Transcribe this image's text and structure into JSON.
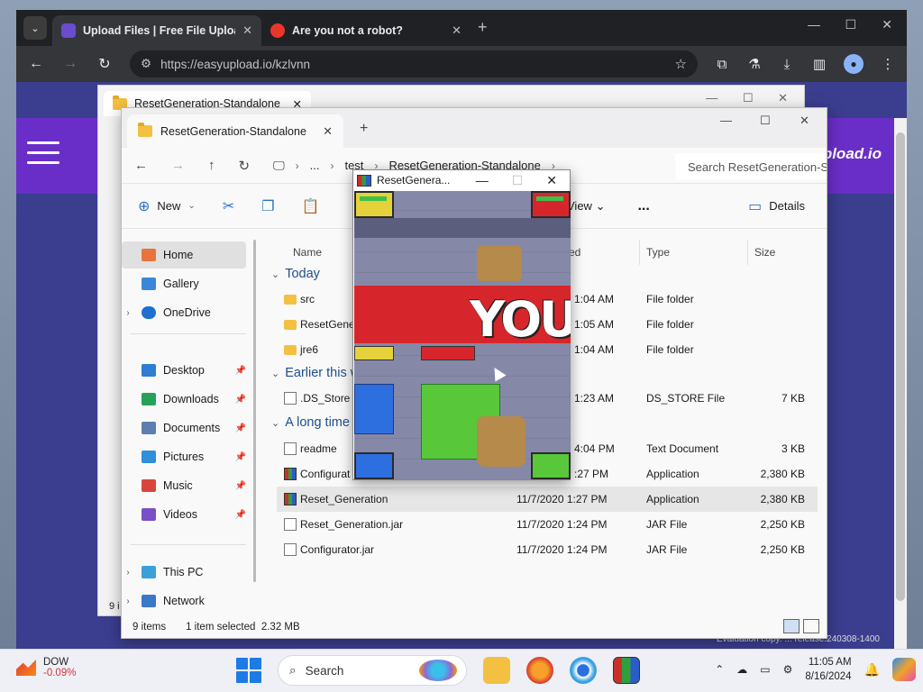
{
  "browser": {
    "tabs": [
      {
        "title": "Upload Files | Free File Upload",
        "active": true
      },
      {
        "title": "Are you not a robot?",
        "active": false
      }
    ],
    "url": "https://easyupload.io/kzlvnn",
    "site_brand": "pload.io"
  },
  "bg_explorer": {
    "tab_title": "ResetGeneration-Standalone"
  },
  "explorer": {
    "tab_title": "ResetGeneration-Standalone",
    "breadcrumb": [
      "...",
      "test",
      "ResetGeneration-Standalone"
    ],
    "search_placeholder": "Search ResetGeneration-Standalone",
    "commands": {
      "new": "New",
      "view": "View",
      "details": "Details",
      "more": "..."
    },
    "sidebar": [
      {
        "label": "Home",
        "icon": "home-icon",
        "selected": true
      },
      {
        "label": "Gallery",
        "icon": "gallery-icon"
      },
      {
        "label": "OneDrive",
        "icon": "cloud-icon"
      },
      {
        "label": "Desktop",
        "icon": "desktop-icon",
        "pinned": true
      },
      {
        "label": "Downloads",
        "icon": "download-icon",
        "pinned": true
      },
      {
        "label": "Documents",
        "icon": "documents-icon",
        "pinned": true
      },
      {
        "label": "Pictures",
        "icon": "pictures-icon",
        "pinned": true
      },
      {
        "label": "Music",
        "icon": "music-icon",
        "pinned": true
      },
      {
        "label": "Videos",
        "icon": "videos-icon",
        "pinned": true
      },
      {
        "label": "This PC",
        "icon": "pc-icon"
      },
      {
        "label": "Network",
        "icon": "network-icon"
      }
    ],
    "columns": {
      "name": "Name",
      "modified": "ed",
      "type": "Type",
      "size": "Size"
    },
    "groups": [
      {
        "label": "Today"
      },
      {
        "label": "Earlier this w"
      },
      {
        "label": "A long time"
      }
    ],
    "files": [
      {
        "name": "src",
        "modified": "1:04 AM",
        "type": "File folder",
        "size": "",
        "icon": "folder"
      },
      {
        "name": "ResetGener",
        "modified": "1:05 AM",
        "type": "File folder",
        "size": "",
        "icon": "folder"
      },
      {
        "name": "jre6",
        "modified": "1:04 AM",
        "type": "File folder",
        "size": "",
        "icon": "folder"
      },
      {
        "name": ".DS_Store",
        "modified": "1:23 AM",
        "type": "DS_STORE File",
        "size": "7 KB",
        "icon": "doc"
      },
      {
        "name": "readme",
        "modified": "4:04 PM",
        "type": "Text Document",
        "size": "3 KB",
        "icon": "doc"
      },
      {
        "name": "Configurat",
        "modified": ":27 PM",
        "type": "Application",
        "size": "2,380 KB",
        "icon": "app"
      },
      {
        "name": "Reset_Generation",
        "modified": "11/7/2020 1:27 PM",
        "type": "Application",
        "size": "2,380 KB",
        "icon": "app",
        "selected": true
      },
      {
        "name": "Reset_Generation.jar",
        "modified": "11/7/2020 1:24 PM",
        "type": "JAR File",
        "size": "2,250 KB",
        "icon": "doc"
      },
      {
        "name": "Configurator.jar",
        "modified": "11/7/2020 1:24 PM",
        "type": "JAR File",
        "size": "2,250 KB",
        "icon": "doc"
      }
    ],
    "status": {
      "items": "9 items",
      "selected": "1 item selected",
      "size": "2.32 MB"
    },
    "bg_count": "9 i"
  },
  "game": {
    "title": "ResetGenera...",
    "banner": "YOU"
  },
  "taskbar": {
    "stock_name": "DOW",
    "stock_change": "-0.09%",
    "search_label": "Search",
    "time": "11:05 AM",
    "date": "8/16/2024"
  },
  "page_footer": "Evaluation copy. ... release.240308-1400"
}
